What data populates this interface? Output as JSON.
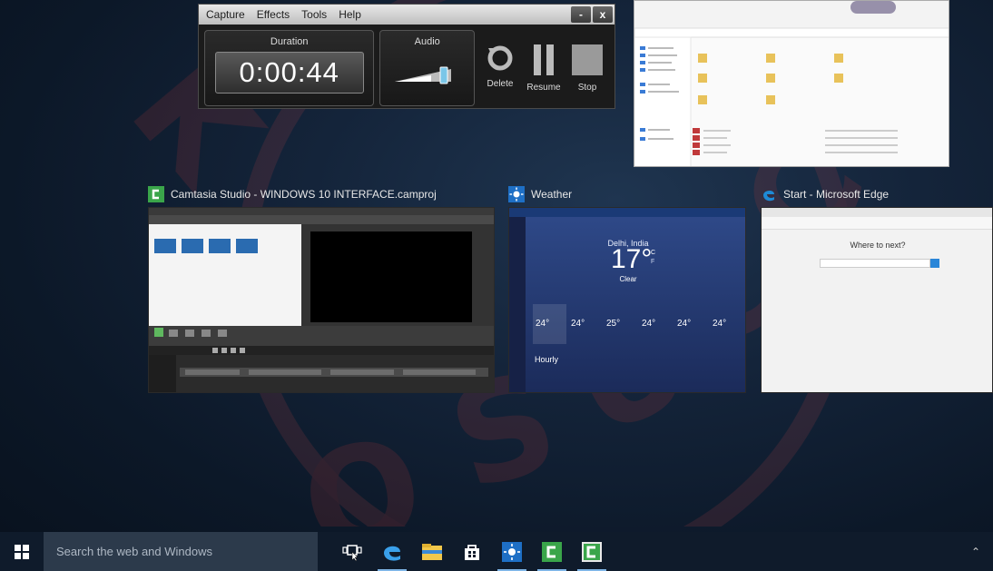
{
  "recorder": {
    "menu": [
      "Capture",
      "Effects",
      "Tools",
      "Help"
    ],
    "window_buttons": {
      "minimize": "-",
      "close": "x"
    },
    "duration_label": "Duration",
    "duration_value": "0:00:44",
    "audio_label": "Audio",
    "delete_label": "Delete",
    "resume_label": "Resume",
    "stop_label": "Stop"
  },
  "task_view": {
    "windows": [
      {
        "title": "Camtasia Studio - WINDOWS 10 INTERFACE.camproj",
        "icon": "camtasia-icon"
      },
      {
        "title": "Weather",
        "icon": "weather-icon"
      },
      {
        "title": "Start - Microsoft Edge",
        "icon": "edge-icon"
      }
    ],
    "weather": {
      "city": "Delhi, India",
      "temp": "17°",
      "unit_c": "C",
      "unit_f": "F",
      "condition": "Clear",
      "hourly_label": "Hourly",
      "forecast_temps": [
        "24°",
        "24°",
        "25°",
        "24°",
        "24°",
        "24°"
      ]
    },
    "edge": {
      "heading": "Where to next?"
    }
  },
  "taskbar": {
    "search_placeholder": "Search the web and Windows",
    "icons": [
      "start-icon",
      "task-view-icon",
      "edge-icon",
      "file-explorer-icon",
      "store-icon",
      "weather-icon",
      "camtasia-recorder-icon",
      "camtasia-studio-icon"
    ],
    "accent": "#7fb5e6"
  },
  "colors": {
    "camtasia_green": "#3aa54a",
    "weather_blue": "#1e6fc5",
    "edge_blue": "#1e8ad6",
    "desktop": "#14243a"
  }
}
